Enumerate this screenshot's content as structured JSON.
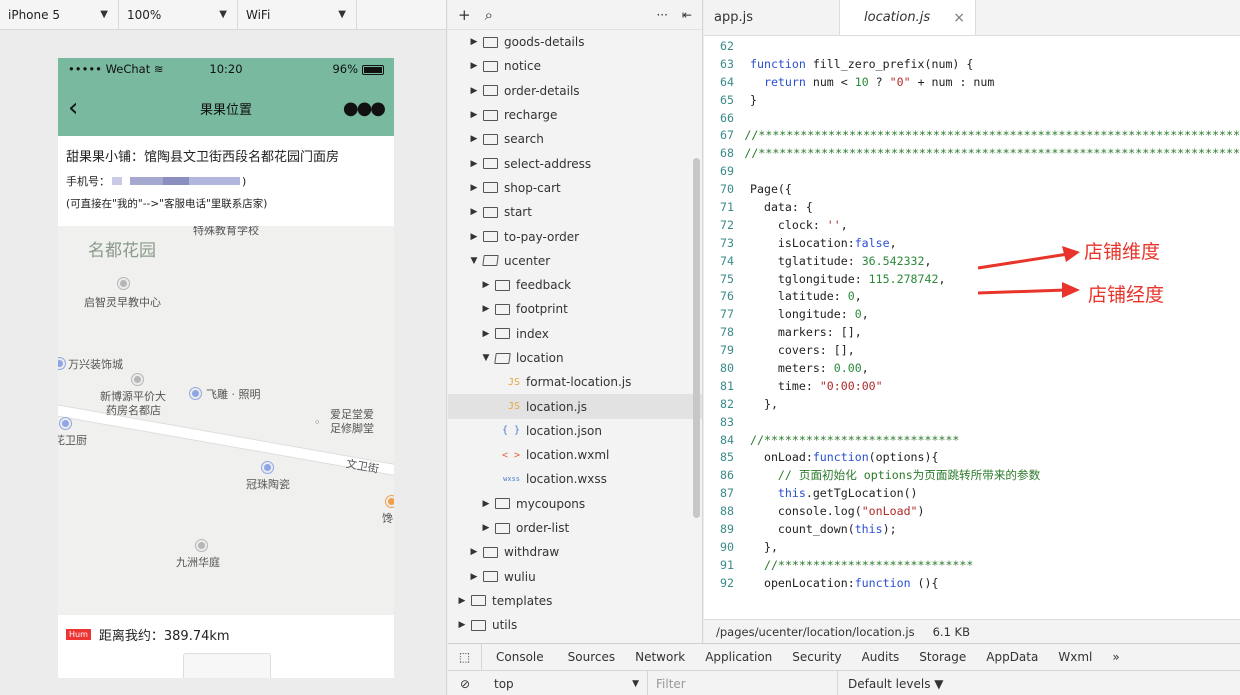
{
  "simulator": {
    "device": "iPhone 5",
    "zoom": "100%",
    "network": "WiFi",
    "status": {
      "carrier": "••••• WeChat",
      "time": "10:20",
      "battery": "96%"
    },
    "nav_title": "果果位置",
    "shop_line": "甜果果小铺：馆陶县文卫街西段名都花园门面房",
    "phone_label": "手机号：",
    "phone_suffix": ")",
    "hint": "(可直接在\"我的\"-->\"客服电话\"里联系店家)",
    "map_labels": {
      "school": "特殊教育学校",
      "garden": "名都花园",
      "edu": "启智灵早教中心",
      "decor": "万兴装饰城",
      "pharmacy1": "新博源平价大",
      "pharmacy2": "药房名都店",
      "photo": "飞雕 · 照明",
      "foot1": "爱足堂爱",
      "foot2": "足修脚堂",
      "kitchen": "花卫厨",
      "street": "文卫街",
      "pottery": "冠珠陶瓷",
      "shop_cut": "馋",
      "court": "九洲华庭"
    },
    "distance_tag": "Hum",
    "distance": "距离我约：389.74km"
  },
  "tree": {
    "toolbar": {
      "add": "+",
      "search": "⌕",
      "more": "···",
      "collapse": "⇤"
    },
    "items": [
      {
        "label": "goods-details",
        "type": "folder",
        "open": false,
        "depth": 1
      },
      {
        "label": "notice",
        "type": "folder",
        "open": false,
        "depth": 1
      },
      {
        "label": "order-details",
        "type": "folder",
        "open": false,
        "depth": 1
      },
      {
        "label": "recharge",
        "type": "folder",
        "open": false,
        "depth": 1
      },
      {
        "label": "search",
        "type": "folder",
        "open": false,
        "depth": 1
      },
      {
        "label": "select-address",
        "type": "folder",
        "open": false,
        "depth": 1
      },
      {
        "label": "shop-cart",
        "type": "folder",
        "open": false,
        "depth": 1
      },
      {
        "label": "start",
        "type": "folder",
        "open": false,
        "depth": 1
      },
      {
        "label": "to-pay-order",
        "type": "folder",
        "open": false,
        "depth": 1
      },
      {
        "label": "ucenter",
        "type": "folder",
        "open": true,
        "depth": 1
      },
      {
        "label": "feedback",
        "type": "folder",
        "open": false,
        "depth": 2
      },
      {
        "label": "footprint",
        "type": "folder",
        "open": false,
        "depth": 2
      },
      {
        "label": "index",
        "type": "folder",
        "open": false,
        "depth": 2
      },
      {
        "label": "location",
        "type": "folder",
        "open": true,
        "depth": 2
      },
      {
        "label": "format-location.js",
        "type": "js",
        "icon": "JS",
        "depth": 3
      },
      {
        "label": "location.js",
        "type": "js",
        "icon": "JS",
        "depth": 3,
        "active": true
      },
      {
        "label": "location.json",
        "type": "json",
        "icon": "{ }",
        "depth": 3
      },
      {
        "label": "location.wxml",
        "type": "wxml",
        "icon": "< >",
        "depth": 3
      },
      {
        "label": "location.wxss",
        "type": "wxss",
        "icon": "wxss",
        "depth": 3
      },
      {
        "label": "mycoupons",
        "type": "folder",
        "open": false,
        "depth": 2
      },
      {
        "label": "order-list",
        "type": "folder",
        "open": false,
        "depth": 2
      },
      {
        "label": "withdraw",
        "type": "folder",
        "open": false,
        "depth": 1
      },
      {
        "label": "wuliu",
        "type": "folder",
        "open": false,
        "depth": 1
      },
      {
        "label": "templates",
        "type": "folder",
        "open": false,
        "depth": 0
      },
      {
        "label": "utils",
        "type": "folder",
        "open": false,
        "depth": 0
      }
    ]
  },
  "editor": {
    "tabs": [
      {
        "label": "app.js",
        "active": false
      },
      {
        "label": "location.js",
        "active": true,
        "close": "×"
      }
    ],
    "lines": [
      {
        "no": "62",
        "html": ""
      },
      {
        "no": "63",
        "html": "<span class='kw'>function</span> fill_zero_prefix(num) {"
      },
      {
        "no": "64",
        "html": "  <span class='kw'>return</span> num &lt; <span class='num'>10</span> ? <span class='str'>\"0\"</span> + num : num"
      },
      {
        "no": "65",
        "html": "}"
      },
      {
        "no": "66",
        "html": ""
      },
      {
        "no": "67",
        "html": "<span class='cm'>//*********************************************************************</span>"
      },
      {
        "no": "68",
        "html": "<span class='cm'>//*********************************************************************</span>"
      },
      {
        "no": "69",
        "html": ""
      },
      {
        "no": "70",
        "html": "Page({"
      },
      {
        "no": "71",
        "html": "  data: {"
      },
      {
        "no": "72",
        "html": "    clock: <span class='str'>''</span>,"
      },
      {
        "no": "73",
        "html": "    isLocation:<span class='kw'>false</span>,"
      },
      {
        "no": "74",
        "html": "    tglatitude: <span class='num'>36.542332</span>,"
      },
      {
        "no": "75",
        "html": "    tglongitude: <span class='num'>115.278742</span>,"
      },
      {
        "no": "76",
        "html": "    latitude: <span class='num'>0</span>,"
      },
      {
        "no": "77",
        "html": "    longitude: <span class='num'>0</span>,"
      },
      {
        "no": "78",
        "html": "    markers: [],"
      },
      {
        "no": "79",
        "html": "    covers: [],"
      },
      {
        "no": "80",
        "html": "    meters: <span class='num'>0.00</span>,"
      },
      {
        "no": "81",
        "html": "    time: <span class='str'>\"0:00:00\"</span>"
      },
      {
        "no": "82",
        "html": "  },"
      },
      {
        "no": "83",
        "html": ""
      },
      {
        "no": "84",
        "html": "<span class='cm'>//****************************</span>"
      },
      {
        "no": "85",
        "html": "  onLoad:<span class='kw'>function</span>(options){"
      },
      {
        "no": "86",
        "html": "    <span class='cm'>// 页面初始化 options为页面跳转所带来的参数</span>"
      },
      {
        "no": "87",
        "html": "    <span class='kw'>this</span>.getTgLocation()"
      },
      {
        "no": "88",
        "html": "    console.log(<span class='str'>\"onLoad\"</span>)"
      },
      {
        "no": "89",
        "html": "    count_down(<span class='kw'>this</span>);"
      },
      {
        "no": "90",
        "html": "  },"
      },
      {
        "no": "91",
        "html": "  <span class='cm'>//****************************</span>"
      },
      {
        "no": "92",
        "html": "  openLocation:<span class='kw'>function</span> (){"
      }
    ],
    "annotations": {
      "lat": "店铺维度",
      "lng": "店铺经度"
    },
    "path": "/pages/ucenter/location/location.js",
    "size": "6.1 KB"
  },
  "devtools": {
    "tabs": [
      "Console",
      "Sources",
      "Network",
      "Application",
      "Security",
      "Audits",
      "Storage",
      "AppData",
      "Wxml",
      "»"
    ],
    "active_tab": "Console",
    "context": "top",
    "filter_placeholder": "Filter",
    "levels": "Default levels ▼",
    "clear_icon": "⊘"
  }
}
